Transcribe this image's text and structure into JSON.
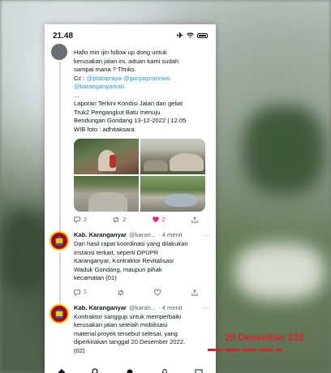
{
  "status_bar": {
    "time": "21.48"
  },
  "tweet1": {
    "text_lines": [
      "Hallo min ijin follow up dong untuk",
      "kerusakan jalan ini, aduan kami sudah",
      "sampai mana ?  Thnks."
    ],
    "cc_label": "Cc : ",
    "cc_links": [
      "@ptabipraya",
      "@ganjarpranowo",
      "@karanganyarkab"
    ],
    "ellipsis": "...",
    "report_lines": [
      "Laporan Terkini Kondisi Jalan dan geliat",
      "Truk2 Pengangkut Batu menuju",
      "Bendungan Gondang 13-12-2022 | 12.05",
      "WIB foto : adhitaksara"
    ],
    "replies": "2",
    "retweets": "2",
    "likes": "2"
  },
  "tweet2": {
    "name": "Kab. Karanganyar",
    "handle": "@karan...",
    "time": "· 4 menit",
    "more": "···",
    "text_lines": [
      "Dari hasil rapat koordinasi yang dilakukan",
      "instansi terkait, seperti DPUPR",
      "Karanganyar, Kontraktor Revitalisasi",
      "Waduk Gondang, maupun pihak",
      "kecamatan (01)"
    ],
    "replies": "1"
  },
  "tweet3": {
    "name": "Kab. Karanganyar",
    "handle": "@karan...",
    "time": "· 4 menit",
    "more": "···",
    "text_lines": [
      "Kontraktor sanggup untuk memperbaiki",
      "kerusakan jalan setelah mobilisasi",
      "material proyek tersebut selesai, yang",
      "diperkirakan tanggal 20 Desember 2022.",
      "(02)"
    ]
  },
  "overlay": {
    "text": "20 Desember 222"
  },
  "colors": {
    "link": "#1d9bf0",
    "like": "#f91880",
    "overlay": "#d8232a"
  }
}
